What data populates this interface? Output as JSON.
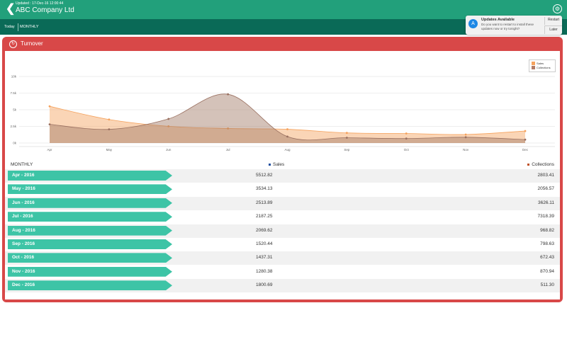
{
  "header": {
    "updated": "Updated : 17-Dec-16 12:00:44",
    "company": "ABC Company Ltd",
    "back_glyph": "❮",
    "settings_glyph": "⚙"
  },
  "subbar": {
    "today": "Today",
    "monthly": "MONTHLY"
  },
  "notification": {
    "icon": "A",
    "title": "Updates Available",
    "message": "Do you want to restart to install these updates now or try tonight?",
    "restart": "Restart",
    "later": "Later"
  },
  "panel": {
    "title": "Turnover",
    "icon_glyph": "↻"
  },
  "table": {
    "col_month": "MONTHLY",
    "col_sales": "Sales",
    "col_collections": "Collections",
    "rows": [
      {
        "month": "Apr - 2016",
        "sales": "5512.82",
        "collections": "2803.41"
      },
      {
        "month": "May - 2016",
        "sales": "3534.13",
        "collections": "2056.57"
      },
      {
        "month": "Jun - 2016",
        "sales": "2513.89",
        "collections": "3626.11"
      },
      {
        "month": "Jul - 2016",
        "sales": "2187.25",
        "collections": "7318.39"
      },
      {
        "month": "Aug - 2016",
        "sales": "2069.62",
        "collections": "968.82"
      },
      {
        "month": "Sep - 2016",
        "sales": "1520.44",
        "collections": "798.63"
      },
      {
        "month": "Oct - 2016",
        "sales": "1437.31",
        "collections": "672.43"
      },
      {
        "month": "Nov - 2016",
        "sales": "1280.38",
        "collections": "870.94"
      },
      {
        "month": "Dec - 2016",
        "sales": "1800.69",
        "collections": "511.30"
      }
    ]
  },
  "colors": {
    "header": "#22a07b",
    "subbar": "#0a6a57",
    "panel": "#d84848",
    "row_label": "#3dc4a6",
    "sales": "#f5a25d",
    "collections": "#b27b66",
    "sales_marker": "#1f4fa0",
    "collections_marker": "#c0522a"
  },
  "chart_data": {
    "type": "area",
    "categories": [
      "Apr",
      "May",
      "Jun",
      "Jul",
      "Aug",
      "Sep",
      "Oct",
      "Nov",
      "Dec"
    ],
    "series": [
      {
        "name": "Sales",
        "values": [
          5512.82,
          3534.13,
          2513.89,
          2187.25,
          2069.62,
          1520.44,
          1437.31,
          1280.38,
          1800.69
        ]
      },
      {
        "name": "Collections",
        "values": [
          2803.41,
          2056.57,
          3626.11,
          7318.39,
          968.82,
          798.63,
          672.43,
          870.94,
          511.3
        ]
      }
    ],
    "yticks": [
      "0k",
      "2.5k",
      "5k",
      "7.5k",
      "10k"
    ],
    "ylim": [
      0,
      10000
    ],
    "grid": true,
    "legend": "top-right"
  }
}
